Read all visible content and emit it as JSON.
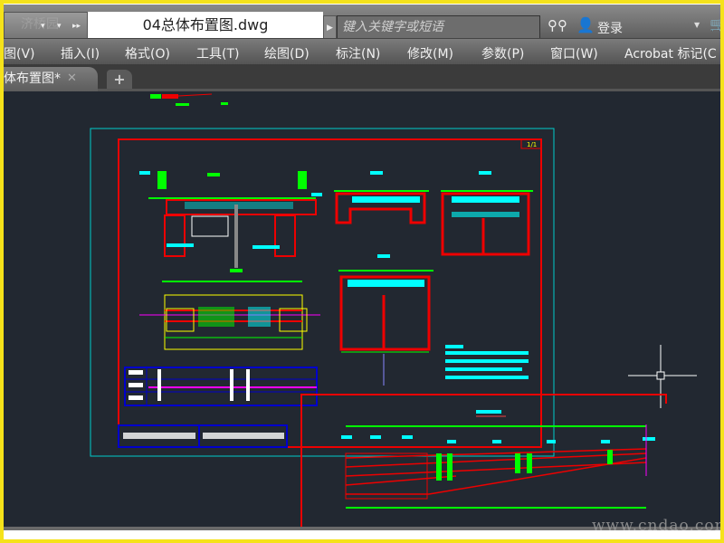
{
  "titlebar": {
    "quick_access_logo": "济桥园",
    "document_title": "04总体布置图.dwg",
    "search_placeholder": "键入关键字或短语",
    "login_label": "登录"
  },
  "menu": [
    {
      "label": "图(V)"
    },
    {
      "label": "插入(I)"
    },
    {
      "label": "格式(O)"
    },
    {
      "label": "工具(T)"
    },
    {
      "label": "绘图(D)"
    },
    {
      "label": "标注(N)"
    },
    {
      "label": "修改(M)"
    },
    {
      "label": "参数(P)"
    },
    {
      "label": "窗口(W)"
    },
    {
      "label": "Acrobat 标记(C"
    }
  ],
  "tabs": {
    "active": "体布置图*",
    "close": "✕",
    "new": "+"
  },
  "drawing": {
    "sheet_number": "1/1",
    "watermark": "www.cndao.com"
  },
  "colors": {
    "canvas": "#222831",
    "accent_border": "#f5e21a"
  }
}
